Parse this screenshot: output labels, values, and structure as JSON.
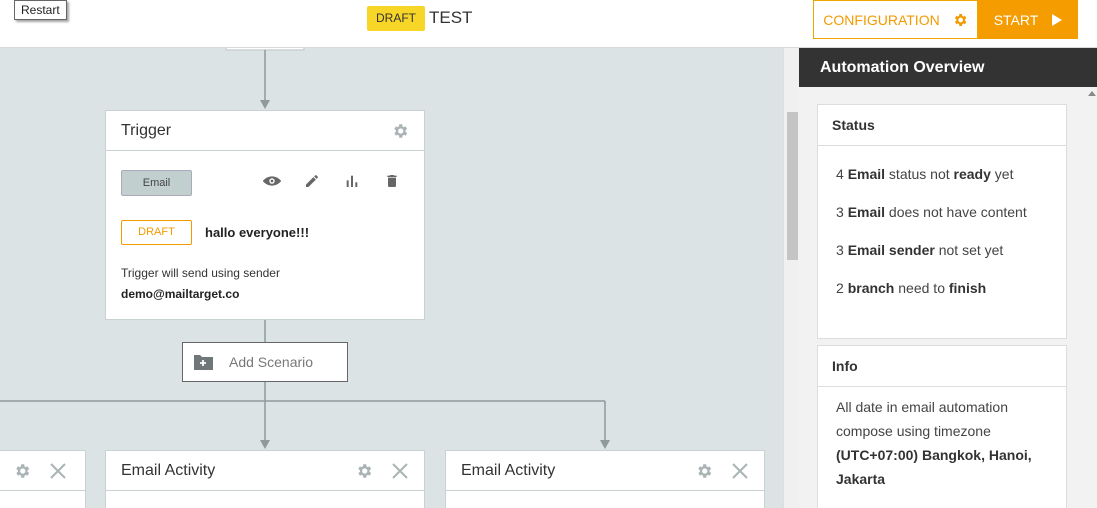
{
  "tooltip": {
    "text": "Restart"
  },
  "header": {
    "status_badge": "DRAFT",
    "title": "TEST",
    "configuration_label": "CONFIGURATION",
    "start_label": "START"
  },
  "colors": {
    "accent": "#f59c00",
    "badge": "#f8d627",
    "canvas": "#dbe3e4",
    "panel_header": "#333333"
  },
  "trigger": {
    "title": "Trigger",
    "channel_chip": "Email",
    "status": "DRAFT",
    "subject": "hallo everyone!!!",
    "sender_note": "Trigger will send using sender",
    "sender_email": "demo@mailtarget.co",
    "action_icons": [
      "eye-icon",
      "pencil-icon",
      "bar-chart-icon",
      "trash-icon"
    ]
  },
  "add_scenario": {
    "label": "Add Scenario"
  },
  "activities": [
    {
      "title": "Email Activity"
    },
    {
      "title": "Email Activity"
    }
  ],
  "overview": {
    "title": "Automation Overview",
    "status": {
      "title": "Status",
      "items": [
        {
          "count": "4",
          "b1": "Email",
          "t1": " status not ",
          "b2": "ready",
          "t2": " yet"
        },
        {
          "count": "3",
          "b1": "Email",
          "t1": " does not have content",
          "b2": "",
          "t2": ""
        },
        {
          "count": "3",
          "b1": "Email sender",
          "t1": " not set yet",
          "b2": "",
          "t2": ""
        },
        {
          "count": "2",
          "b1": "branch",
          "t1": " need to ",
          "b2": "finish",
          "t2": ""
        }
      ]
    },
    "info": {
      "title": "Info",
      "text": "All date in email automation compose using timezone",
      "timezone": "(UTC+07:00) Bangkok, Hanoi, Jakarta"
    }
  }
}
